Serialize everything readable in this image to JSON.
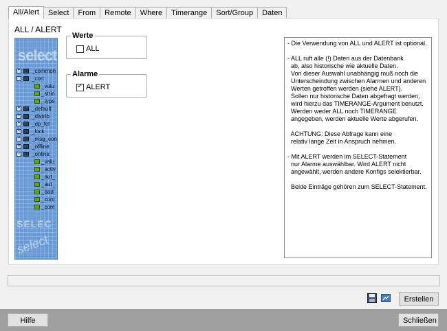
{
  "tabs": [
    {
      "label": "All/Alert",
      "active": true
    },
    {
      "label": "Select",
      "active": false
    },
    {
      "label": "From",
      "active": false
    },
    {
      "label": "Remote",
      "active": false
    },
    {
      "label": "Where",
      "active": false
    },
    {
      "label": "Timerange",
      "active": false
    },
    {
      "label": "Sort/Group",
      "active": false
    },
    {
      "label": "Daten",
      "active": false
    }
  ],
  "page_title": "ALL / ALERT",
  "logo": {
    "watermark_top": "select",
    "watermark_mid": "SELEC",
    "watermark_bottom": "select",
    "tree": [
      {
        "exp": "+",
        "icon": "folder",
        "label": "_common",
        "level": 0
      },
      {
        "exp": "-",
        "icon": "folder",
        "label": "_corr",
        "level": 0
      },
      {
        "exp": "",
        "icon": "leaf",
        "label": "_valu",
        "level": 1
      },
      {
        "exp": "",
        "icon": "leaf",
        "label": "_strin",
        "level": 1
      },
      {
        "exp": "",
        "icon": "leaf",
        "label": "_type",
        "level": 1
      },
      {
        "exp": "+",
        "icon": "folder",
        "label": "_default",
        "level": 0
      },
      {
        "exp": "+",
        "icon": "folder",
        "label": "_distrib",
        "level": 0
      },
      {
        "exp": "+",
        "icon": "folder",
        "label": "_dp_fct",
        "level": 0
      },
      {
        "exp": "+",
        "icon": "folder",
        "label": "_lock",
        "level": 0
      },
      {
        "exp": "+",
        "icon": "folder",
        "label": "_msg_con",
        "level": 0
      },
      {
        "exp": "+",
        "icon": "folder",
        "label": "_offline",
        "level": 0
      },
      {
        "exp": "-",
        "icon": "folder",
        "label": "_online",
        "level": 0
      },
      {
        "exp": "",
        "icon": "leaf",
        "label": "_valu",
        "level": 1
      },
      {
        "exp": "",
        "icon": "leaf",
        "label": "_activ",
        "level": 1
      },
      {
        "exp": "",
        "icon": "leaf",
        "label": "_aut_",
        "level": 1
      },
      {
        "exp": "",
        "icon": "leaf",
        "label": "_aut_",
        "level": 1
      },
      {
        "exp": "",
        "icon": "leaf",
        "label": "_bad",
        "level": 1
      },
      {
        "exp": "",
        "icon": "leaf",
        "label": "_com",
        "level": 1
      },
      {
        "exp": "",
        "icon": "leaf",
        "label": "_com",
        "level": 1
      }
    ]
  },
  "werte": {
    "title": "Werte",
    "checkbox_label": "ALL",
    "checked": false
  },
  "alarme": {
    "title": "Alarme",
    "checkbox_label": "ALERT",
    "checked": true
  },
  "info_lines": [
    "- Die Verwendung von ALL und ALERT ist optional.",
    "",
    "- ALL ruft alle (!) Daten aus der Datenbank",
    "  ab, also historische wie aktuelle Daten.",
    "  Von dieser Auswahl unabhängig muß noch die",
    "  Unterscheindung zwischen Alarmen und anderen",
    "  Werten getroffen werden (siehe ALERT).",
    "  Sollen nur historische Daten abgefragt werden,",
    "  wird hierzu das TIMERANGE-Argument benutzt.",
    "  Werden weder ALL noch TIMERANGE",
    "  angegeben, werden aktuelle Werte abgerufen.",
    "",
    "  ACHTUNG: Diese Abfrage kann eine",
    "  relativ lange Zeit in Anspruch nehmen.",
    "",
    "- Mit ALERT werden im SELECT-Statement",
    "  nur Alarme auswählbar. Wird ALERT nicht",
    "  angewählt, werden andere Konfigs selektierbar.",
    "",
    "  Beide Einträge gehören zum SELECT-Statement."
  ],
  "buttons": {
    "erstellen": "Erstellen",
    "hilfe": "Hilfe",
    "schliessen": "Schließen"
  },
  "colors": {
    "logo_bg": "#6a9bd6",
    "bottom_bar": "#a0a0a0"
  }
}
